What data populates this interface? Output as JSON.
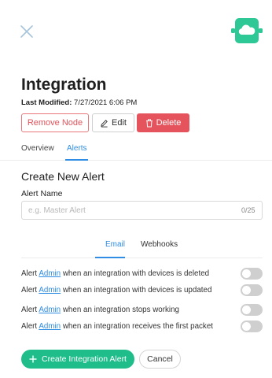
{
  "header": {
    "title": "Integration",
    "last_modified_label": "Last Modified:",
    "last_modified_value": "7/27/2021 6:06 PM"
  },
  "actions": {
    "remove_node_label": "Remove Node",
    "edit_label": "Edit",
    "delete_label": "Delete"
  },
  "tabs": [
    {
      "label": "Overview",
      "active": false
    },
    {
      "label": "Alerts",
      "active": true
    }
  ],
  "create_alert": {
    "section_title": "Create New Alert",
    "name_label": "Alert Name",
    "name_value": "",
    "name_placeholder": "e.g. Master Alert",
    "char_count": "0/25"
  },
  "subtabs": [
    {
      "label": "Email",
      "active": true
    },
    {
      "label": "Webhooks",
      "active": false
    }
  ],
  "alerts": [
    {
      "prefix": "Alert",
      "link": "Admin",
      "suffix": "when an integration with devices is deleted",
      "enabled": false
    },
    {
      "prefix": "Alert",
      "link": "Admin",
      "suffix": "when an integration with devices is updated",
      "enabled": false
    },
    {
      "prefix": "Alert",
      "link": "Admin",
      "suffix": "when an integration stops working",
      "enabled": false
    },
    {
      "prefix": "Alert",
      "link": "Admin",
      "suffix": "when an integration receives the first packet",
      "enabled": false
    }
  ],
  "footer": {
    "create_label": "Create Integration Alert",
    "cancel_label": "Cancel"
  },
  "colors": {
    "accent_blue": "#2f8de4",
    "brand_green": "#1fbd8a",
    "danger_red": "#e5535c"
  },
  "icons": {
    "close": "close-icon",
    "node": "cloud-icon",
    "edit": "pencil-icon",
    "delete": "trash-icon",
    "create": "plus-icon"
  }
}
